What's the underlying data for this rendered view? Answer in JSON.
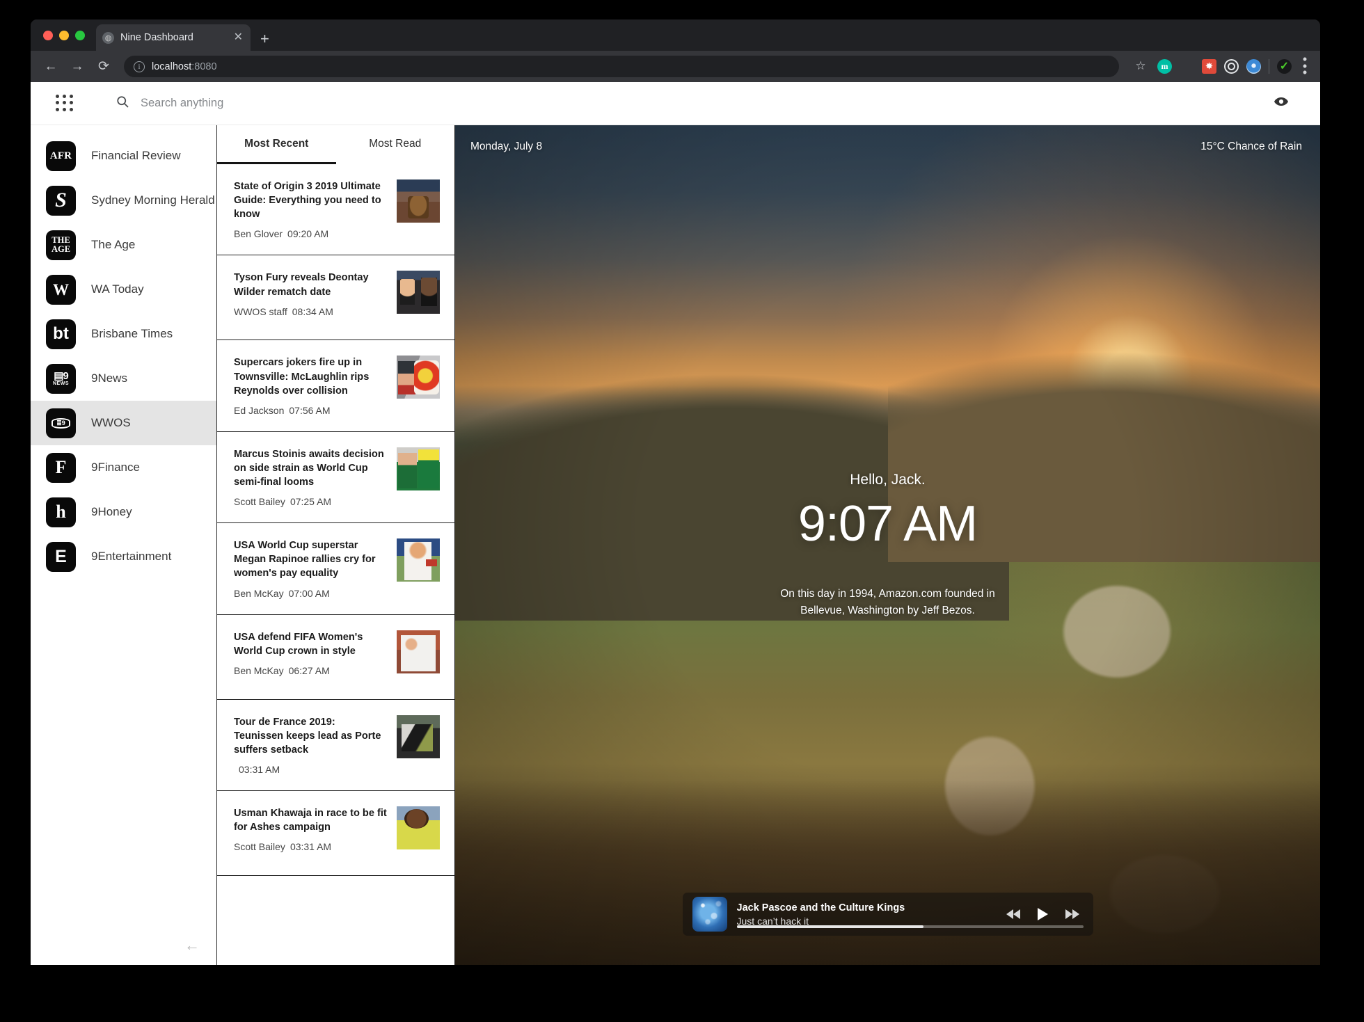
{
  "browser": {
    "tab_title": "Nine Dashboard",
    "tab_close_label": "✕",
    "new_tab_label": "+",
    "back_label": "←",
    "forward_label": "→",
    "reload_label": "⟳",
    "info_label": "i",
    "url_host": "localhost",
    "url_port": ":8080",
    "star_label": "☆",
    "menu_label": "⋮",
    "extensions": [
      "m",
      "grid-ext-icon",
      "red-ext-icon",
      "target-ext-icon",
      "blue-ext-icon",
      "green-check-ext-icon"
    ]
  },
  "app_bar": {
    "apps_grid_name": "apps-grid",
    "search_placeholder": "Search anything",
    "search_value": "",
    "eye_icon_name": "eye-icon"
  },
  "sidebar": {
    "collapse_label": "←",
    "items": [
      {
        "label": "Financial Review",
        "logo": "AFR",
        "logo_class": "afr",
        "selected": false
      },
      {
        "label": "Sydney Morning Herald",
        "logo": "S",
        "logo_class": "smh",
        "selected": false
      },
      {
        "label": "The Age",
        "logo": "THE AGE",
        "logo_class": "age",
        "selected": false
      },
      {
        "label": "WA Today",
        "logo": "W",
        "logo_class": "wat",
        "selected": false
      },
      {
        "label": "Brisbane Times",
        "logo": "bt",
        "logo_class": "bt",
        "selected": false
      },
      {
        "label": "9News",
        "logo": "NEWS",
        "logo_class": "news",
        "selected": false
      },
      {
        "label": "WWOS",
        "logo": "WWOS",
        "logo_class": "wwos",
        "selected": true
      },
      {
        "label": "9Finance",
        "logo": "F",
        "logo_class": "fin",
        "selected": false
      },
      {
        "label": "9Honey",
        "logo": "h",
        "logo_class": "hon",
        "selected": false
      },
      {
        "label": "9Entertainment",
        "logo": "E",
        "logo_class": "ent",
        "selected": false
      }
    ]
  },
  "news": {
    "tabs": [
      {
        "label": "Most Recent",
        "active": true
      },
      {
        "label": "Most Read",
        "active": false
      }
    ],
    "items": [
      {
        "title": "State of Origin 3 2019 Ultimate Guide: Everything you need to know",
        "author": "Ben Glover",
        "time": "09:20 AM",
        "thumb": "thumb-origin"
      },
      {
        "title": "Tyson Fury reveals Deontay Wilder rematch date",
        "author": "WWOS staff",
        "time": "08:34 AM",
        "thumb": "thumb-fury"
      },
      {
        "title": "Supercars jokers fire up in Townsville: McLaughlin rips Reynolds over collision",
        "author": "Ed Jackson",
        "time": "07:56 AM",
        "thumb": "thumb-super"
      },
      {
        "title": "Marcus Stoinis awaits decision on side strain as World Cup semi-final looms",
        "author": "Scott Bailey",
        "time": "07:25 AM",
        "thumb": "thumb-stoinis"
      },
      {
        "title": "USA World Cup superstar Megan Rapinoe rallies cry for women's pay equality",
        "author": "Ben McKay",
        "time": "07:00 AM",
        "thumb": "thumb-rapinoe"
      },
      {
        "title": "USA defend FIFA Women's World Cup crown in style",
        "author": "Ben McKay",
        "time": "06:27 AM",
        "thumb": "thumb-usa"
      },
      {
        "title": "Tour de France 2019: Teunissen keeps lead as Porte suffers setback",
        "author": "",
        "time": "03:31 AM",
        "thumb": "thumb-tour"
      },
      {
        "title": "Usman Khawaja in race to be fit for Ashes campaign",
        "author": "Scott Bailey",
        "time": "03:31 AM",
        "thumb": "thumb-khawaja"
      }
    ]
  },
  "hero": {
    "date": "Monday, July 8",
    "weather": "15°C Chance of Rain",
    "greeting": "Hello, Jack.",
    "clock": "9:07 AM",
    "on_this_day": "On this day in 1994, Amazon.com founded in Bellevue, Washington by Jeff Bezos."
  },
  "media_player": {
    "title": "Jack Pascoe and the Culture Kings",
    "subtitle": "Just can’t hack it",
    "prev_label": "⏮",
    "play_label": "▶",
    "next_label": "⏭",
    "progress_percent": 54
  }
}
